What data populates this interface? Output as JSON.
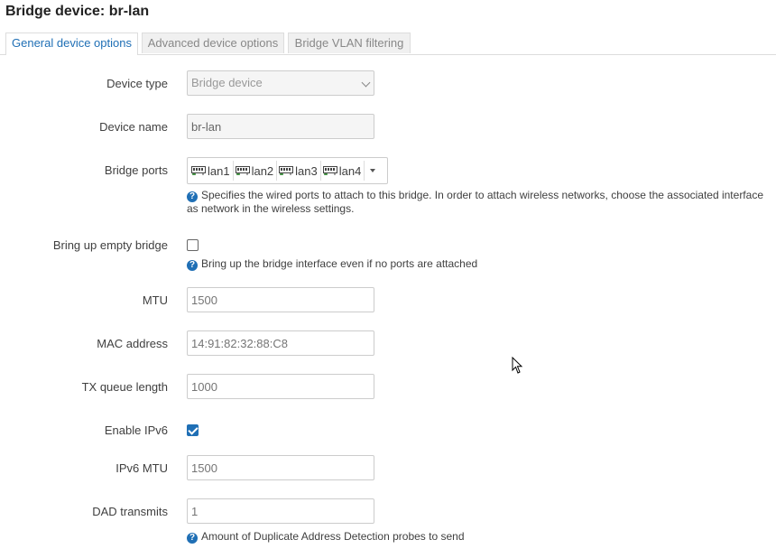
{
  "title": "Bridge device: br-lan",
  "tabs": [
    {
      "label": "General device options",
      "active": true
    },
    {
      "label": "Advanced device options",
      "active": false
    },
    {
      "label": "Bridge VLAN filtering",
      "active": false
    }
  ],
  "fields": {
    "device_type": {
      "label": "Device type",
      "value": "Bridge device"
    },
    "device_name": {
      "label": "Device name",
      "value": "br-lan"
    },
    "bridge_ports": {
      "label": "Bridge ports",
      "ports": [
        "lan1",
        "lan2",
        "lan3",
        "lan4"
      ],
      "help": "Specifies the wired ports to attach to this bridge. In order to attach wireless networks, choose the associated interface as network in the wireless settings."
    },
    "bring_up_empty": {
      "label": "Bring up empty bridge",
      "checked": false,
      "help": "Bring up the bridge interface even if no ports are attached"
    },
    "mtu": {
      "label": "MTU",
      "placeholder": "1500"
    },
    "mac_address": {
      "label": "MAC address",
      "placeholder": "14:91:82:32:88:C8"
    },
    "tx_queue_length": {
      "label": "TX queue length",
      "placeholder": "1000"
    },
    "enable_ipv6": {
      "label": "Enable IPv6",
      "checked": true
    },
    "ipv6_mtu": {
      "label": "IPv6 MTU",
      "placeholder": "1500"
    },
    "dad_transmits": {
      "label": "DAD transmits",
      "placeholder": "1",
      "help": "Amount of Duplicate Address Detection probes to send"
    }
  },
  "colors": {
    "accent": "#1f6fb5",
    "border": "#cccccc",
    "text": "#404040"
  }
}
